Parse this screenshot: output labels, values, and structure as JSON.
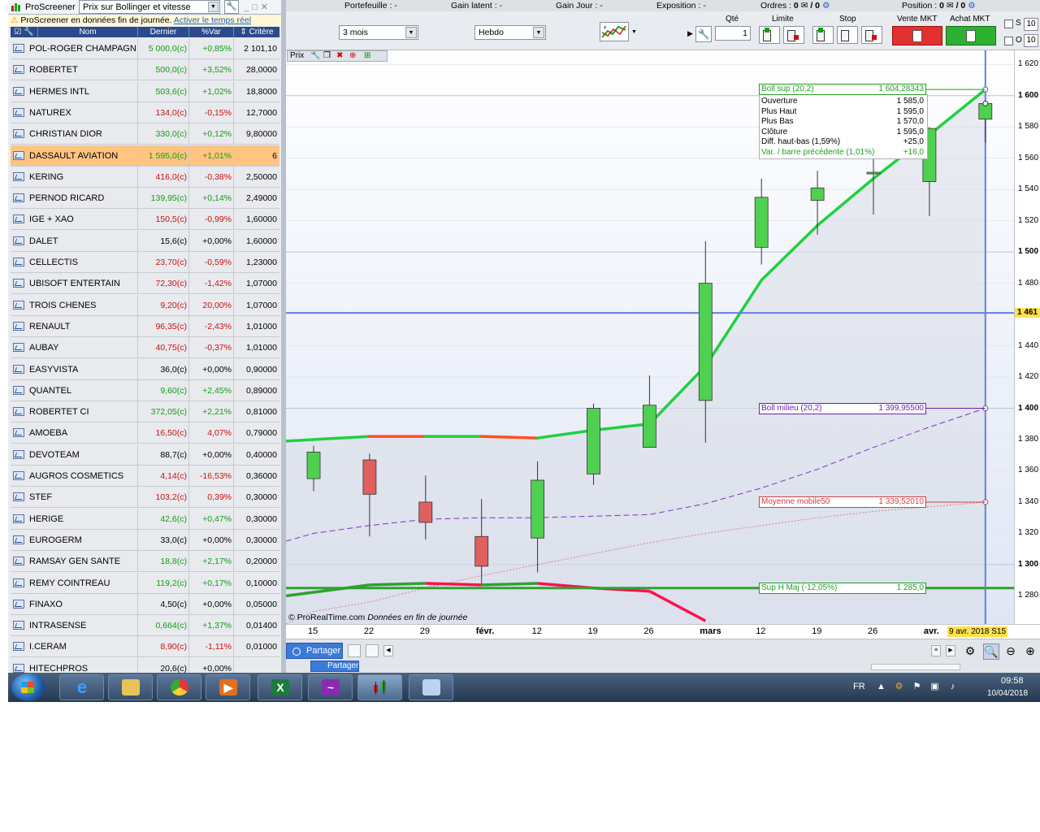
{
  "screener": {
    "app_name": "ProScreener",
    "selected_screen": "Prix sur Bollinger et vitesse",
    "notice": "ProScreener en données fin de journée.",
    "notice_link": "Activer le temps réel",
    "columns": [
      "Nom",
      "Dernier",
      "%Var",
      "Critère"
    ],
    "rows": [
      {
        "name": "POL-ROGER CHAMPAGN",
        "price": "5 000,0(c)",
        "var": "+0,85%",
        "crit": "2 101,10",
        "dir": "up"
      },
      {
        "name": "ROBERTET",
        "price": "500,0(c)",
        "var": "+3,52%",
        "crit": "28,0000",
        "dir": "up"
      },
      {
        "name": "HERMES INTL",
        "price": "503,6(c)",
        "var": "+1,02%",
        "crit": "18,8000",
        "dir": "up"
      },
      {
        "name": "NATUREX",
        "price": "134,0(c)",
        "var": "-0,15%",
        "crit": "12,7000",
        "dir": "dn"
      },
      {
        "name": "CHRISTIAN DIOR",
        "price": "330,0(c)",
        "var": "+0,12%",
        "crit": "9,80000",
        "dir": "up"
      },
      {
        "name": "DASSAULT AVIATION",
        "price": "1 595,0(c)",
        "var": "+1,01%",
        "crit": "6",
        "dir": "up"
      },
      {
        "name": "KERING",
        "price": "416,0(c)",
        "var": "-0,38%",
        "crit": "2,50000",
        "dir": "dn"
      },
      {
        "name": "PERNOD RICARD",
        "price": "139,95(c)",
        "var": "+0,14%",
        "crit": "2,49000",
        "dir": "up"
      },
      {
        "name": "IGE + XAO",
        "price": "150,5(c)",
        "var": "-0,99%",
        "crit": "1,60000",
        "dir": "dn"
      },
      {
        "name": "DALET",
        "price": "15,6(c)",
        "var": "+0,00%",
        "crit": "1,60000",
        "dir": "fl"
      },
      {
        "name": "CELLECTIS",
        "price": "23,70(c)",
        "var": "-0,59%",
        "crit": "1,23000",
        "dir": "dn"
      },
      {
        "name": "UBISOFT ENTERTAIN",
        "price": "72,30(c)",
        "var": "-1,42%",
        "crit": "1,07000",
        "dir": "dn"
      },
      {
        "name": "TROIS CHENES",
        "price": "9,20(c)",
        "var": "20,00%",
        "crit": "1,07000",
        "dir": "dn"
      },
      {
        "name": "RENAULT",
        "price": "96,35(c)",
        "var": "-2,43%",
        "crit": "1,01000",
        "dir": "dn"
      },
      {
        "name": "AUBAY",
        "price": "40,75(c)",
        "var": "-0,37%",
        "crit": "1,01000",
        "dir": "dn"
      },
      {
        "name": "EASYVISTA",
        "price": "36,0(c)",
        "var": "+0,00%",
        "crit": "0,90000",
        "dir": "fl"
      },
      {
        "name": "QUANTEL",
        "price": "9,60(c)",
        "var": "+2,45%",
        "crit": "0,89000",
        "dir": "up"
      },
      {
        "name": "ROBERTET CI",
        "price": "372,05(c)",
        "var": "+2,21%",
        "crit": "0,81000",
        "dir": "up"
      },
      {
        "name": "AMOEBA",
        "price": "16,50(c)",
        "var": "4,07%",
        "crit": "0,79000",
        "dir": "dn"
      },
      {
        "name": "DEVOTEAM",
        "price": "88,7(c)",
        "var": "+0,00%",
        "crit": "0,40000",
        "dir": "fl"
      },
      {
        "name": "AUGROS COSMETICS",
        "price": "4,14(c)",
        "var": "-16,53%",
        "crit": "0,36000",
        "dir": "dn"
      },
      {
        "name": "STEF",
        "price": "103,2(c)",
        "var": "0,39%",
        "crit": "0,30000",
        "dir": "dn"
      },
      {
        "name": "HERIGE",
        "price": "42,6(c)",
        "var": "+0,47%",
        "crit": "0,30000",
        "dir": "up"
      },
      {
        "name": "EUROGERM",
        "price": "33,0(c)",
        "var": "+0,00%",
        "crit": "0,30000",
        "dir": "fl"
      },
      {
        "name": "RAMSAY GEN SANTE",
        "price": "18,8(c)",
        "var": "+2,17%",
        "crit": "0,20000",
        "dir": "up"
      },
      {
        "name": "REMY COINTREAU",
        "price": "119,2(c)",
        "var": "+0,17%",
        "crit": "0,10000",
        "dir": "up"
      },
      {
        "name": "FINAXO",
        "price": "4,50(c)",
        "var": "+0,00%",
        "crit": "0,05000",
        "dir": "fl"
      },
      {
        "name": "INTRASENSE",
        "price": "0,664(c)",
        "var": "+1,37%",
        "crit": "0,01400",
        "dir": "up"
      },
      {
        "name": "I.CERAM",
        "price": "8,90(c)",
        "var": "-1,11%",
        "crit": "0,01000",
        "dir": "dn"
      },
      {
        "name": "HITECHPROS",
        "price": "20,6(c)",
        "var": "+0,00%",
        "crit": "",
        "dir": "fl"
      }
    ],
    "selected_index": 5
  },
  "account": {
    "portefeuille": "Portefeuille : -",
    "gain_latent": "Gain latent : -",
    "gain_jour": "Gain Jour : -",
    "exposition": "Exposition : -",
    "ordres": "Ordres : ",
    "ordres_a": "0",
    "ordres_b": "/ 0",
    "position": "Position : ",
    "position_a": "0",
    "position_b": "/ 0"
  },
  "toolbar": {
    "period": "3 mois",
    "interval": "Hebdo",
    "qty_label": "Qté",
    "qty_value": "1",
    "limite_label": "Limite",
    "stop_label": "Stop",
    "sell_label": "Vente MKT",
    "buy_label": "Achat MKT",
    "s_label": "S",
    "o_label": "O",
    "s_value": "10",
    "o_value": "10",
    "pct": "%"
  },
  "chart": {
    "tab_label": "Prix",
    "credit_site": "© ProRealTime.com",
    "credit_note": "Données en fin de journée",
    "current_price_label": "1 461",
    "current_date_label": "9 avr. 2018 S15",
    "price_ticks": [
      {
        "label": "1 620",
        "bold": false
      },
      {
        "label": "1 600",
        "bold": true
      },
      {
        "label": "1 580",
        "bold": false
      },
      {
        "label": "1 560",
        "bold": false
      },
      {
        "label": "1 540",
        "bold": false
      },
      {
        "label": "1 520",
        "bold": false
      },
      {
        "label": "1 500",
        "bold": true
      },
      {
        "label": "1 480",
        "bold": false
      },
      {
        "label": "1 440",
        "bold": false
      },
      {
        "label": "1 420",
        "bold": false
      },
      {
        "label": "1 400",
        "bold": true
      },
      {
        "label": "1 380",
        "bold": false
      },
      {
        "label": "1 360",
        "bold": false
      },
      {
        "label": "1 340",
        "bold": false
      },
      {
        "label": "1 320",
        "bold": false
      },
      {
        "label": "1 300",
        "bold": true
      },
      {
        "label": "1 280",
        "bold": false
      }
    ],
    "date_ticks": [
      {
        "label": "15",
        "bold": false
      },
      {
        "label": "22",
        "bold": false
      },
      {
        "label": "29",
        "bold": false
      },
      {
        "label": "févr.",
        "bold": true
      },
      {
        "label": "12",
        "bold": false
      },
      {
        "label": "19",
        "bold": false
      },
      {
        "label": "26",
        "bold": false
      },
      {
        "label": "mars",
        "bold": true
      },
      {
        "label": "12",
        "bold": false
      },
      {
        "label": "19",
        "bold": false
      },
      {
        "label": "26",
        "bold": false
      },
      {
        "label": "avr.",
        "bold": true
      }
    ],
    "boll_sup": {
      "label": "Boll sup (20,2)",
      "value": "1 604,28343"
    },
    "boll_mid": {
      "label": "Boll milieu (20,2)",
      "value": "1 399,95500"
    },
    "mm50": {
      "label": "Moyenne mobile50",
      "value": "1 339,52010"
    },
    "sup": {
      "label": "Sup H Maj (-12,05%)",
      "value": "1 285,0"
    },
    "tooltip": [
      {
        "label": "Ouverture",
        "value": "1 585,0"
      },
      {
        "label": "Plus Haut",
        "value": "1 595,0"
      },
      {
        "label": "Plus Bas",
        "value": "1 570,0"
      },
      {
        "label": "Clôture",
        "value": "1 595,0"
      },
      {
        "label": "Diff. haut-bas (1,59%)",
        "value": "+25,0"
      },
      {
        "label": "Var. / barre précédente (1,01%)",
        "value": "+16,0"
      }
    ]
  },
  "chart_data": {
    "type": "candlestick",
    "x": [
      "15",
      "22",
      "29",
      "févr.",
      "12",
      "19",
      "26",
      "mars",
      "12",
      "19",
      "26",
      "avr.",
      "9 avr."
    ],
    "candles": [
      {
        "o": 1355,
        "h": 1376,
        "l": 1347,
        "c": 1372
      },
      {
        "o": 1367,
        "h": 1371,
        "l": 1318,
        "c": 1345
      },
      {
        "o": 1340,
        "h": 1357,
        "l": 1316,
        "c": 1327
      },
      {
        "o": 1318,
        "h": 1342,
        "l": 1288,
        "c": 1299
      },
      {
        "o": 1317,
        "h": 1366,
        "l": 1295,
        "c": 1354
      },
      {
        "o": 1358,
        "h": 1403,
        "l": 1351,
        "c": 1400
      },
      {
        "o": 1375,
        "h": 1421,
        "l": 1375,
        "c": 1402
      },
      {
        "o": 1405,
        "h": 1507,
        "l": 1378,
        "c": 1480
      },
      {
        "o": 1503,
        "h": 1547,
        "l": 1492,
        "c": 1535
      },
      {
        "o": 1533,
        "h": 1552,
        "l": 1511,
        "c": 1541
      },
      {
        "o": 1551,
        "h": 1566,
        "l": 1524,
        "c": 1551
      },
      {
        "o": 1545,
        "h": 1580,
        "l": 1523,
        "c": 1579
      },
      {
        "o": 1585,
        "h": 1595,
        "l": 1570,
        "c": 1595
      }
    ],
    "boll_sup": [
      1380,
      1382,
      1382,
      1382,
      1381,
      1386,
      1390,
      1427,
      1482,
      1517,
      1547,
      1575,
      1604
    ],
    "boll_mid": [
      1320,
      1325,
      1329,
      1330,
      1330,
      1331,
      1332,
      1339,
      1349,
      1361,
      1375,
      1388,
      1400
    ],
    "boll_inf": [
      1283,
      1287,
      1288,
      1287,
      1288,
      1285,
      1283,
      1264
    ],
    "mm50": [
      1270,
      1276,
      1285,
      1293,
      1300,
      1307,
      1314,
      1320,
      1325,
      1330,
      1334,
      1337,
      1340
    ],
    "sup_level": 1285,
    "current_price": 1461,
    "ylim": [
      1262,
      1629
    ]
  },
  "taskbar": {
    "lang": "FR",
    "time": "09:58",
    "date": "10/04/2018"
  }
}
